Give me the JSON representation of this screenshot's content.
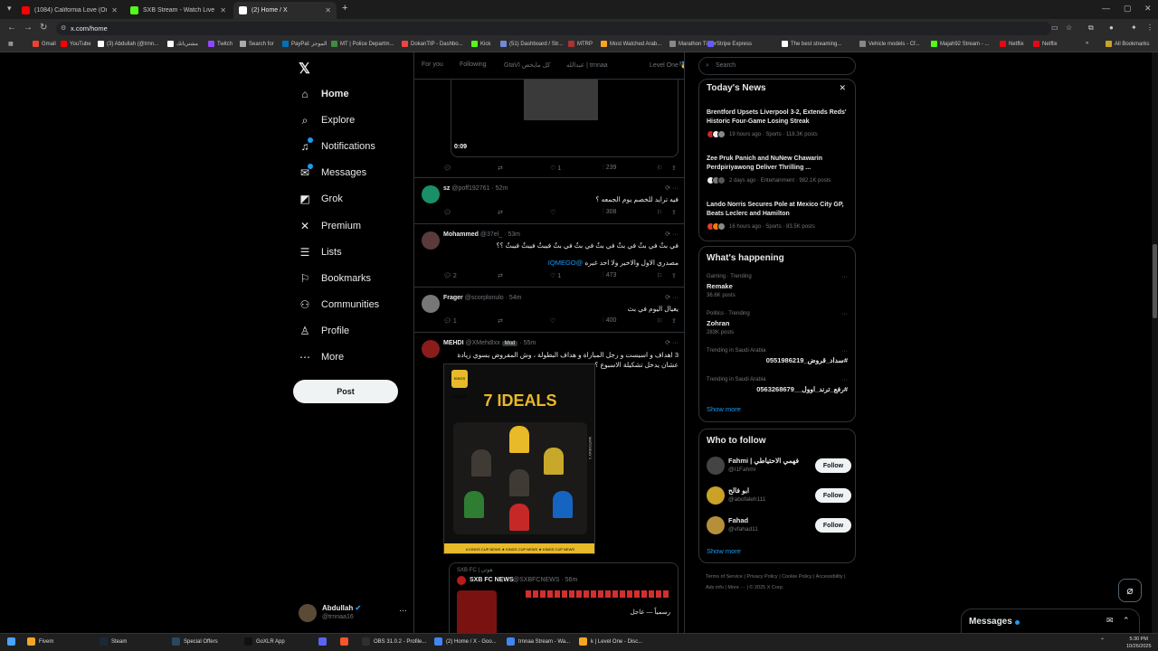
{
  "browser": {
    "tabs": [
      {
        "label": "(1084) California Love (Original",
        "color": "#ff0000",
        "active": false
      },
      {
        "label": "SXB Stream - Watch Live on Kic",
        "color": "#53fc18",
        "active": false
      },
      {
        "label": "(2) Home / X",
        "color": "#ffffff",
        "active": true
      }
    ],
    "url": "x.com/home",
    "bookmarks": [
      {
        "label": "Gmail",
        "color": "#ea4335"
      },
      {
        "label": "YouTube",
        "color": "#ff0000"
      },
      {
        "label": "(3) Abdullah (@trnn...",
        "color": "#ffffff"
      },
      {
        "label": "مشترياتك",
        "color": "#ffffff"
      },
      {
        "label": "Twitch",
        "color": "#9146ff"
      },
      {
        "label": "Search for",
        "color": "#aaaaaa"
      },
      {
        "label": "PayPal: الموجز",
        "color": "#0070ba"
      },
      {
        "label": "MT | Police Departm...",
        "color": "#3c8d40"
      },
      {
        "label": "DokanTIP - Dashbo...",
        "color": "#e44"
      },
      {
        "label": "Kick",
        "color": "#53fc18"
      },
      {
        "label": "(51) Dashboard / Str...",
        "color": "#7289da"
      },
      {
        "label": "MTRP",
        "color": "#aa3333"
      },
      {
        "label": "Most Watched Arab...",
        "color": "#f5a623"
      },
      {
        "label": "Marathon Timer",
        "color": "#888888"
      },
      {
        "label": "Stripe Express",
        "color": "#635bff"
      },
      {
        "label": "The best streaming...",
        "color": "#ffffff"
      },
      {
        "label": "Vehicle models - Cf...",
        "color": "#888888"
      },
      {
        "label": "Majah92 Stream - ...",
        "color": "#53fc18"
      },
      {
        "label": "Netflix",
        "color": "#e50914"
      },
      {
        "label": "Netflix",
        "color": "#e50914"
      }
    ],
    "all_bookmarks": "All Bookmarks"
  },
  "nav": {
    "items": [
      {
        "label": "Home",
        "icon": "home-icon",
        "glyph": "⌂",
        "bold": true
      },
      {
        "label": "Explore",
        "icon": "search-icon",
        "glyph": "⌕"
      },
      {
        "label": "Notifications",
        "icon": "bell-icon",
        "glyph": "♫",
        "dot": true
      },
      {
        "label": "Messages",
        "icon": "mail-icon",
        "glyph": "✉",
        "dot": true
      },
      {
        "label": "Grok",
        "icon": "grok-icon",
        "glyph": "◩"
      },
      {
        "label": "Premium",
        "icon": "x-icon",
        "glyph": "✕"
      },
      {
        "label": "Lists",
        "icon": "list-icon",
        "glyph": "☰"
      },
      {
        "label": "Bookmarks",
        "icon": "bookmark-icon",
        "glyph": "⚐"
      },
      {
        "label": "Communities",
        "icon": "people-icon",
        "glyph": "⚇"
      },
      {
        "label": "Profile",
        "icon": "person-icon",
        "glyph": "♙"
      },
      {
        "label": "More",
        "icon": "more-icon",
        "glyph": "⋯"
      }
    ],
    "post_label": "Post",
    "account": {
      "name": "Abdullah",
      "handle": "@trnnaa16"
    }
  },
  "feed": {
    "tabs": [
      "For you",
      "Following",
      "GtaVI كل مايخص",
      "عبدالله | trnnaa",
      "Level One 🥇",
      "M"
    ],
    "video": {
      "time": "0:09",
      "stats": {
        "reply": "",
        "retweet": "",
        "like": "1",
        "views": "239"
      }
    },
    "tweets": [
      {
        "name": "sz",
        "handle": "@poff192761 · 52m",
        "text": "فيه ترايد للخصم يوم الجمعه ؟",
        "avatar": "#1a8f6a",
        "stats": {
          "reply": "",
          "retweet": "",
          "like": "",
          "views": "308"
        }
      },
      {
        "name": "Mohammed",
        "handle": "@37el_ · 53m",
        "text": "في بثٌ في بثٌ في بثٌ في بثٌ في بثٌ في بثٌ فيبثٌ فيبثٌ فيبثٌ ؟؟",
        "text2": "مصدري الاول والاخير ولا احد غيره",
        "mention": "@IQMEGO",
        "avatar": "#5a3a3a",
        "stats": {
          "reply": "2",
          "retweet": "",
          "like": "1",
          "views": "473"
        }
      },
      {
        "name": "Frager",
        "handle": "@scorplonulo · 54m",
        "text": "يعيال اليوم في بث",
        "avatar": "#777777",
        "stats": {
          "reply": "1",
          "retweet": "",
          "like": "",
          "views": "400"
        }
      },
      {
        "name": "MEHDI",
        "handle": "@XMehdIxx",
        "badge": "Mod",
        "time": "· 55m",
        "text": "3 اهداف و اسيست و رجل المباراة و هداف البطولة ، وش المفروض يسوي زيادة عشان يدخل تشكيلة الاسبوع ؟",
        "avatar": "#8a1c1c"
      }
    ],
    "image": {
      "league": "KINGS LEAGUE",
      "title": "7 IDEALS",
      "side": "MATCHDAY 1",
      "footer": "# KINGS CUP NEWS ★ KINGS CUP NEWS ★ KINGS CUP NEWS"
    },
    "quote": {
      "context": "SXB FC | هوتي",
      "name": "SXB FC NEWS",
      "handle": "@SXBFCNEWS · 56m",
      "text": "رسمياً — عاجل"
    }
  },
  "right": {
    "search_placeholder": "Search",
    "news_title": "Today's News",
    "news": [
      {
        "title": "Brentford Upsets Liverpool 3-2, Extends Reds' Historic Four-Game Losing Streak",
        "meta": "19 hours ago · Sports · 118.3K posts"
      },
      {
        "title": "Zee Pruk Panich and NuNew Chawarin Perdpiriyawong Deliver Thrilling ...",
        "meta": "2 days ago · Entertainment · 982.1K posts"
      },
      {
        "title": "Lando Norris Secures Pole at Mexico City GP, Beats Leclerc and Hamilton",
        "meta": "16 hours ago · Sports · 83.5K posts"
      }
    ],
    "happening_title": "What's happening",
    "trends": [
      {
        "cat": "Gaming · Trending",
        "name": "Remake",
        "posts": "36.6K posts"
      },
      {
        "cat": "Politics · Trending",
        "name": "Zohran",
        "posts": "283K posts"
      },
      {
        "cat": "Trending in Saudi Arabia",
        "name": "#سداد_قروض_0551986219",
        "posts": ""
      },
      {
        "cat": "Trending in Saudi Arabia",
        "name": "#رفع_ترند_اوول__0563268679",
        "posts": ""
      }
    ],
    "show_more": "Show more",
    "follow_title": "Who to follow",
    "follow": [
      {
        "name": "Fahmi | فهمي الاحتياطي",
        "handle": "@I1Fahmi",
        "color": "#444444"
      },
      {
        "name": "ابو فالح",
        "handle": "@abofaleh111",
        "color": "#c9a227"
      },
      {
        "name": "Fahad",
        "handle": "@vfahad11",
        "color": "#b58f3a"
      }
    ],
    "follow_label": "Follow",
    "footer": "Terms of Service | Privacy Policy | Cookie Policy | Accessibility | Ads info | More ··· | © 2025 X Corp."
  },
  "drawer": {
    "title": "Messages"
  },
  "taskbar": {
    "items": [
      {
        "label": "Fivem",
        "color": "#f5a623"
      },
      {
        "label": "Steam",
        "color": "#1b2838"
      },
      {
        "label": "Special Offers",
        "color": "#2a475e"
      },
      {
        "label": "GoXLR App",
        "color": "#111111"
      },
      {
        "label": "",
        "color": "#5865f2"
      },
      {
        "label": "",
        "color": "#fb542b"
      },
      {
        "label": "OBS 31.0.2 - Profile...",
        "color": "#302e31"
      },
      {
        "label": "(2) Home / X - Goo...",
        "color": "#4285f4"
      },
      {
        "label": "trnnaa Stream - Wa...",
        "color": "#4285f4"
      },
      {
        "label": "k | Level One - Disc...",
        "color": "#f5a623"
      }
    ],
    "time": "5:30 PM",
    "date": "10/26/2025"
  }
}
